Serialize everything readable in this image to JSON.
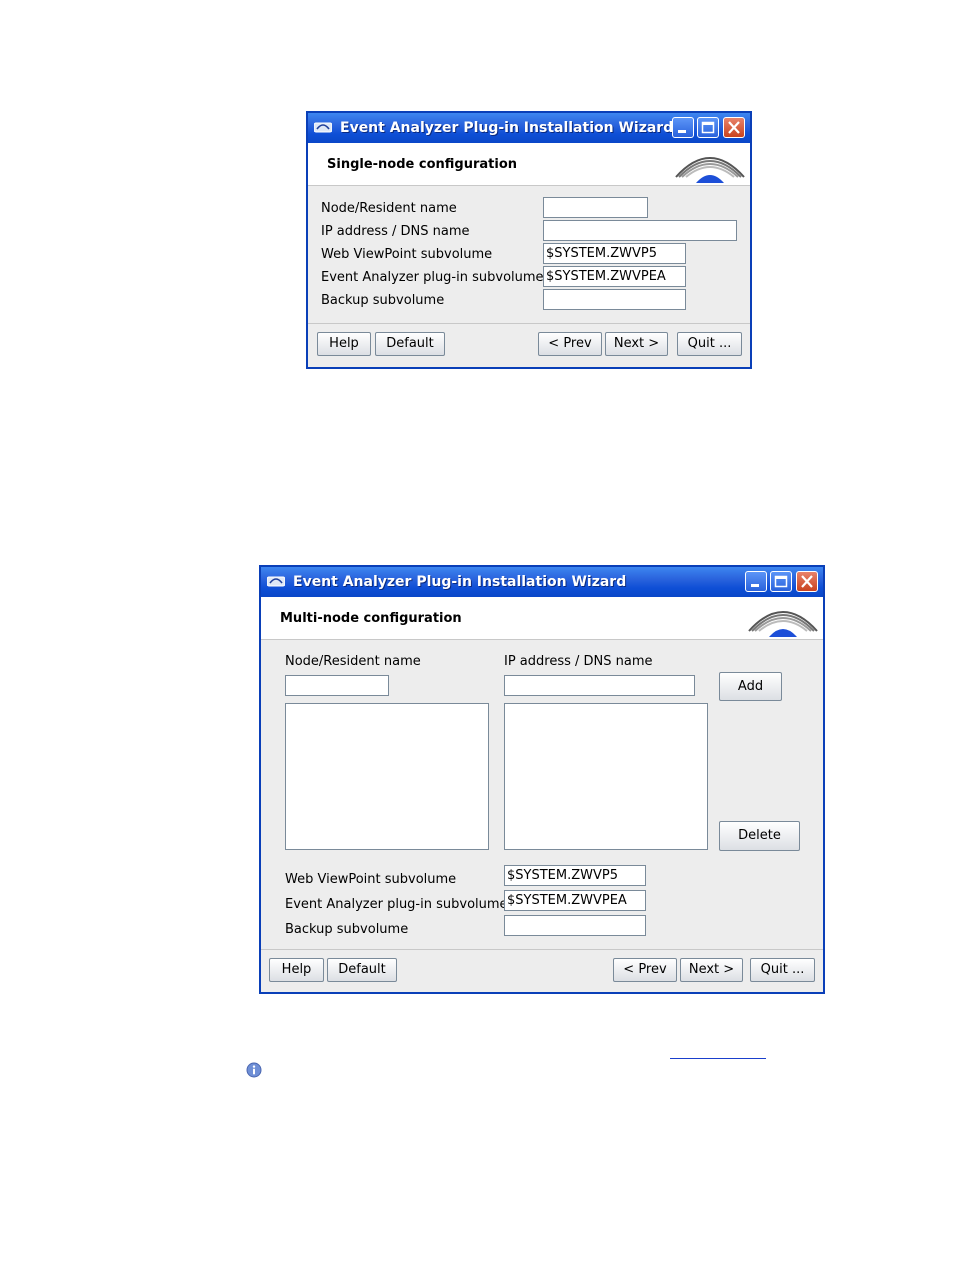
{
  "window1": {
    "title": "Event Analyzer Plug-in Installation Wizard",
    "header": "Single-node configuration",
    "fields": [
      {
        "label": "Node/Resident name",
        "value": ""
      },
      {
        "label": "IP address / DNS name",
        "value": ""
      },
      {
        "label": "Web ViewPoint subvolume",
        "value": "$SYSTEM.ZWVP5"
      },
      {
        "label": "Event Analyzer plug-in subvolume",
        "value": "$SYSTEM.ZWVPEA"
      },
      {
        "label": "Backup subvolume",
        "value": ""
      }
    ],
    "buttons": {
      "help": "Help",
      "default": "Default",
      "prev": "< Prev",
      "next": "Next >",
      "quit": "Quit ..."
    }
  },
  "window2": {
    "title": "Event Analyzer Plug-in Installation Wizard",
    "header": "Multi-node configuration",
    "node_label": "Node/Resident name",
    "node_value": "",
    "ip_label": "IP address / DNS name",
    "ip_value": "",
    "add": "Add",
    "delete": "Delete",
    "fields": [
      {
        "label": "Web ViewPoint subvolume",
        "value": "$SYSTEM.ZWVP5"
      },
      {
        "label": "Event Analyzer plug-in subvolume",
        "value": "$SYSTEM.ZWVPEA"
      },
      {
        "label": "Backup subvolume",
        "value": ""
      }
    ],
    "buttons": {
      "help": "Help",
      "default": "Default",
      "prev": "< Prev",
      "next": "Next >",
      "quit": "Quit ..."
    }
  },
  "icons": {
    "app": "app-icon",
    "minimize": "minimize-icon",
    "maximize": "maximize-icon",
    "close": "close-icon",
    "logo": "logo-icon",
    "info": "info-icon"
  },
  "colors": {
    "titlebar": "#0a47c8",
    "close": "#c9431f",
    "window_bg": "#ededed"
  }
}
